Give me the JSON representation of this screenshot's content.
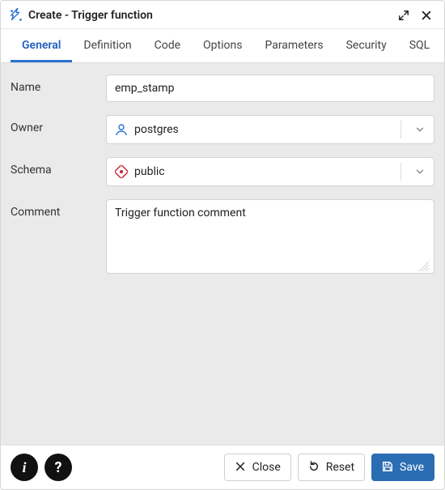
{
  "dialog": {
    "title": "Create - Trigger function"
  },
  "tabs": [
    {
      "label": "General",
      "active": true
    },
    {
      "label": "Definition"
    },
    {
      "label": "Code"
    },
    {
      "label": "Options"
    },
    {
      "label": "Parameters"
    },
    {
      "label": "Security"
    },
    {
      "label": "SQL"
    }
  ],
  "form": {
    "name": {
      "label": "Name",
      "value": "emp_stamp"
    },
    "owner": {
      "label": "Owner",
      "value": "postgres"
    },
    "schema": {
      "label": "Schema",
      "value": "public"
    },
    "comment": {
      "label": "Comment",
      "value": "Trigger function comment"
    }
  },
  "footer": {
    "close": "Close",
    "reset": "Reset",
    "save": "Save"
  },
  "icons": {
    "info": "i",
    "help": "?"
  }
}
